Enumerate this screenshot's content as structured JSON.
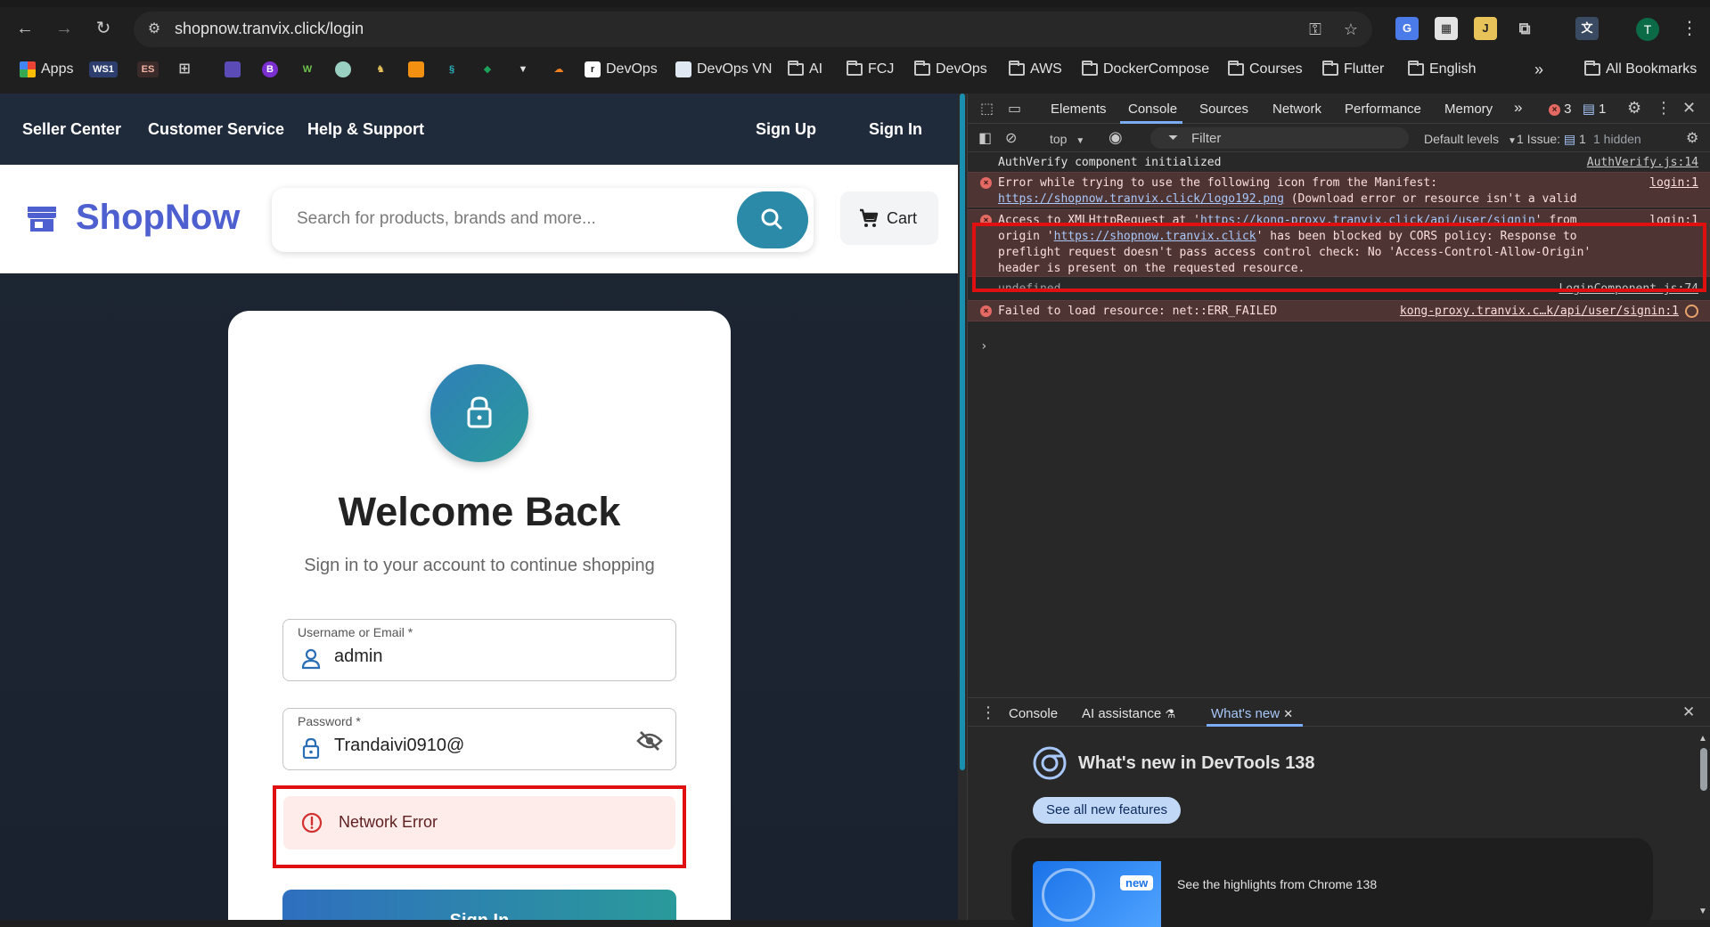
{
  "browser": {
    "url": "shopnow.tranvix.click/login",
    "profile_initial": "T",
    "bookmarks": [
      {
        "label": "Apps",
        "icon": "apps-grid-icon"
      },
      {
        "label": "WS1",
        "icon": "ws1-icon"
      },
      {
        "label": "ES",
        "icon": "es-icon"
      },
      {
        "label": "",
        "icon": "grid-icon"
      },
      {
        "label": "DevOps",
        "icon": "devops-favicon"
      },
      {
        "label": "DevOps VN",
        "icon": "devops-vn-favicon"
      },
      {
        "label": "AI",
        "icon": "folder-icon"
      },
      {
        "label": "FCJ",
        "icon": "folder-icon"
      },
      {
        "label": "DevOps",
        "icon": "folder-icon"
      },
      {
        "label": "AWS",
        "icon": "folder-icon"
      },
      {
        "label": "DockerCompose",
        "icon": "folder-icon"
      },
      {
        "label": "Courses",
        "icon": "folder-icon"
      },
      {
        "label": "Flutter",
        "icon": "folder-icon"
      },
      {
        "label": "English",
        "icon": "folder-icon"
      }
    ],
    "more_bookmarks": "»",
    "all_bookmarks": "All Bookmarks"
  },
  "site": {
    "topbar": {
      "seller_center": "Seller Center",
      "customer_service": "Customer Service",
      "help_support": "Help & Support",
      "sign_up": "Sign Up",
      "sign_in": "Sign In"
    },
    "brand": "ShopNow",
    "search_placeholder": "Search for products, brands and more...",
    "cart_label": "Cart",
    "colors": {
      "brand": "#4e5fd0",
      "accent": "#2a8aa7",
      "error": "#e01010"
    }
  },
  "login": {
    "title": "Welcome Back",
    "subtitle": "Sign in to your account to continue shopping",
    "username_label": "Username or Email *",
    "username_value": "admin",
    "password_label": "Password *",
    "password_value": "Trandaivi0910@",
    "error_message": "Network Error",
    "submit_label": "Sign In"
  },
  "devtools": {
    "tabs": [
      "Elements",
      "Console",
      "Sources",
      "Network",
      "Performance",
      "Memory"
    ],
    "active_tab": "Console",
    "more_tabs": "»",
    "error_count": "3",
    "message_count": "1",
    "context": "top",
    "filter_placeholder": "Filter",
    "levels": "Default levels",
    "issues": "1 Issue:",
    "issues_count": "1",
    "hidden": "1 hidden",
    "logs": [
      {
        "type": "info",
        "message": "AuthVerify component initialized",
        "source": "AuthVerify.js:14"
      },
      {
        "type": "error",
        "message_pre": "Error while trying to use the following icon from the Manifest: ",
        "link": "https://shopnow.tranvix.click/logo192.png",
        "message_post": " (Download error or resource isn't a valid image)",
        "source": "login:1"
      },
      {
        "type": "error",
        "message_pre": "Access to XMLHttpRequest at '",
        "link": "https://kong-proxy.tranvix.click/api/user/signin",
        "message_mid": "' from origin '",
        "link2": "https://shopnow.tranvix.click",
        "message_post": "' has been blocked by CORS policy: Response to preflight request doesn't pass access control check: No 'Access-Control-Allow-Origin' header is present on the requested resource.",
        "source": "login:1"
      },
      {
        "type": "verbose",
        "message": "undefined",
        "source": "LoginComponent.js:74"
      },
      {
        "type": "error",
        "message": "Failed to load resource: net::ERR_FAILED",
        "source": "kong-proxy.tranvix.c…k/api/user/signin:1"
      }
    ],
    "prompt": "›",
    "drawer": {
      "tabs": [
        "Console",
        "AI assistance",
        "What's new"
      ],
      "active_tab": "What's new",
      "whats_new_title": "What's new in DevTools 138",
      "see_all": "See all new features",
      "badge": "new",
      "highlight": "See the highlights from Chrome 138"
    }
  }
}
